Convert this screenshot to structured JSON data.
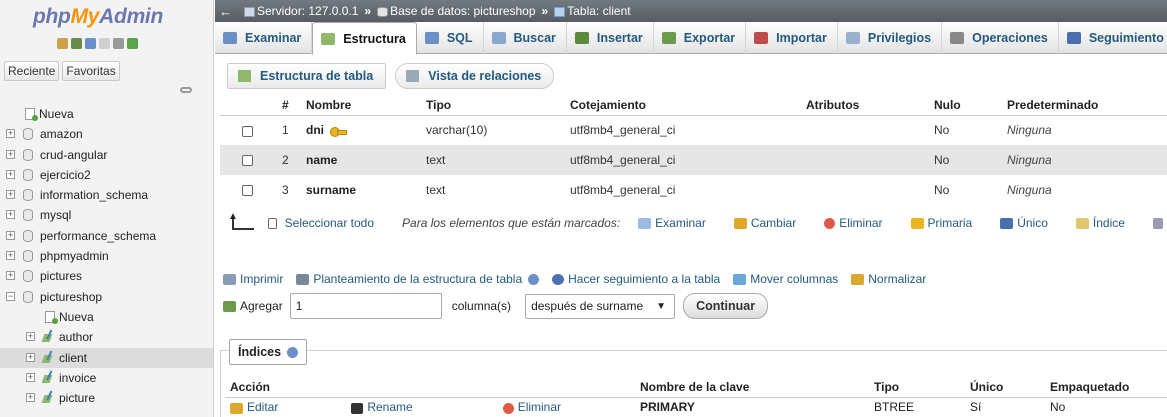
{
  "logo": {
    "php": "php",
    "my": "My",
    "admin": "Admin"
  },
  "left_tabs": {
    "recent": "Reciente",
    "favorites": "Favoritas"
  },
  "tree": [
    {
      "label": "Nueva",
      "type": "new",
      "level": 0
    },
    {
      "label": "amazon",
      "type": "db",
      "level": 0
    },
    {
      "label": "crud-angular",
      "type": "db",
      "level": 0
    },
    {
      "label": "ejercicio2",
      "type": "db",
      "level": 0
    },
    {
      "label": "information_schema",
      "type": "db",
      "level": 0
    },
    {
      "label": "mysql",
      "type": "db",
      "level": 0
    },
    {
      "label": "performance_schema",
      "type": "db",
      "level": 0
    },
    {
      "label": "phpmyadmin",
      "type": "db",
      "level": 0
    },
    {
      "label": "pictures",
      "type": "db",
      "level": 0
    },
    {
      "label": "pictureshop",
      "type": "db",
      "level": 0,
      "expanded": true
    },
    {
      "label": "Nueva",
      "type": "new",
      "level": 1
    },
    {
      "label": "author",
      "type": "table",
      "level": 1
    },
    {
      "label": "client",
      "type": "table",
      "level": 1,
      "selected": true
    },
    {
      "label": "invoice",
      "type": "table",
      "level": 1
    },
    {
      "label": "picture",
      "type": "table",
      "level": 1
    }
  ],
  "breadcrumb": {
    "server": "Servidor: 127.0.0.1",
    "database": "Base de datos: pictureshop",
    "table": "Tabla: client",
    "separator": "»"
  },
  "tabs": [
    {
      "label": "Examinar",
      "icon": "browse-icon",
      "color": "#6b8fc7"
    },
    {
      "label": "Estructura",
      "icon": "structure-icon",
      "color": "#8fb86a",
      "active": true
    },
    {
      "label": "SQL",
      "icon": "sql-icon",
      "color": "#6b8fc7"
    },
    {
      "label": "Buscar",
      "icon": "search-icon",
      "color": "#8aa8cf"
    },
    {
      "label": "Insertar",
      "icon": "insert-icon",
      "color": "#5a8a3a"
    },
    {
      "label": "Exportar",
      "icon": "export-icon",
      "color": "#6a9a4a"
    },
    {
      "label": "Importar",
      "icon": "import-icon",
      "color": "#c04b4b"
    },
    {
      "label": "Privilegios",
      "icon": "privileges-icon",
      "color": "#9ab0d0"
    },
    {
      "label": "Operaciones",
      "icon": "wrench-icon",
      "color": "#888888"
    },
    {
      "label": "Seguimiento",
      "icon": "eye-icon",
      "color": "#4a6fb0"
    }
  ],
  "subtabs": {
    "structure": "Estructura de tabla",
    "relations": "Vista de relaciones"
  },
  "columns_header": [
    "#",
    "Nombre",
    "Tipo",
    "Cotejamiento",
    "Atributos",
    "Nulo",
    "Predeterminado"
  ],
  "columns": [
    {
      "num": "1",
      "name": "dni",
      "type": "varchar(10)",
      "collation": "utf8mb4_general_ci",
      "attributes": "",
      "null": "No",
      "default": "Ninguna",
      "primary": true
    },
    {
      "num": "2",
      "name": "name",
      "type": "text",
      "collation": "utf8mb4_general_ci",
      "attributes": "",
      "null": "No",
      "default": "Ninguna"
    },
    {
      "num": "3",
      "name": "surname",
      "type": "text",
      "collation": "utf8mb4_general_ci",
      "attributes": "",
      "null": "No",
      "default": "Ninguna"
    }
  ],
  "bulk": {
    "select_all": "Seleccionar todo",
    "marked_text": "Para los elementos que están marcados:",
    "browse": "Examinar",
    "change": "Cambiar",
    "delete": "Eliminar",
    "primary": "Primaria",
    "unique": "Único",
    "index": "Índice"
  },
  "actions": {
    "print": "Imprimir",
    "propose": "Planteamiento de la estructura de tabla",
    "track": "Hacer seguimiento a la tabla",
    "move": "Mover columnas",
    "normalize": "Normalizar"
  },
  "add": {
    "label": "Agregar",
    "count": "1",
    "unit": "columna(s)",
    "position": "después de surname",
    "button": "Continuar"
  },
  "indexes": {
    "legend": "Índices",
    "headers": [
      "Acción",
      "Nombre de la clave",
      "Tipo",
      "Único",
      "Empaquetado"
    ],
    "row": {
      "edit": "Editar",
      "rename": "Rename",
      "delete": "Eliminar",
      "key_name": "PRIMARY",
      "type": "BTREE",
      "unique": "Sí",
      "packed": "No"
    }
  }
}
